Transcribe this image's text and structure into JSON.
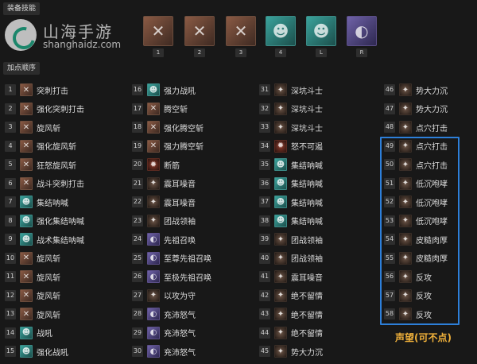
{
  "headers": {
    "equip_skills": "装备技能",
    "skill_order": "加点顺序"
  },
  "watermark": {
    "title": "山海手游",
    "url": "shanghaidz.com"
  },
  "colors": {
    "accent_blue": "#2d7fd9",
    "reputation_text": "#f0b13a",
    "icon_brown": "#6e4a3c",
    "icon_teal": "#2c8b86",
    "icon_purple": "#5b4e88",
    "icon_dark": "#4a3a30"
  },
  "equip": [
    {
      "key": "1",
      "icon": "spear-strike-icon",
      "kind": "brown"
    },
    {
      "key": "2",
      "icon": "whirlwind-icon",
      "kind": "brown"
    },
    {
      "key": "3",
      "icon": "ram-horn-icon",
      "kind": "brown"
    },
    {
      "key": "4",
      "icon": "rallying-cry-icon",
      "kind": "teal"
    },
    {
      "key": "L",
      "icon": "war-cry-icon",
      "kind": "teal"
    },
    {
      "key": "R",
      "icon": "ring-wrath-icon",
      "kind": "purple"
    }
  ],
  "skills": [
    {
      "n": "1",
      "name": "突刺打击",
      "kind": "brown"
    },
    {
      "n": "2",
      "name": "强化突刺打击",
      "kind": "brown"
    },
    {
      "n": "3",
      "name": "旋风斩",
      "kind": "brown"
    },
    {
      "n": "4",
      "name": "强化旋风斩",
      "kind": "brown"
    },
    {
      "n": "5",
      "name": "狂怒旋风斩",
      "kind": "brown"
    },
    {
      "n": "6",
      "name": "战斗突刺打击",
      "kind": "brown"
    },
    {
      "n": "7",
      "name": "集结呐喊",
      "kind": "teal"
    },
    {
      "n": "8",
      "name": "强化集结呐喊",
      "kind": "teal"
    },
    {
      "n": "9",
      "name": "战术集结呐喊",
      "kind": "teal"
    },
    {
      "n": "10",
      "name": "旋风斩",
      "kind": "brown"
    },
    {
      "n": "11",
      "name": "旋风斩",
      "kind": "brown"
    },
    {
      "n": "12",
      "name": "旋风斩",
      "kind": "brown"
    },
    {
      "n": "13",
      "name": "旋风斩",
      "kind": "brown"
    },
    {
      "n": "14",
      "name": "战吼",
      "kind": "teal"
    },
    {
      "n": "15",
      "name": "强化战吼",
      "kind": "teal"
    },
    {
      "n": "16",
      "name": "强力战吼",
      "kind": "teal"
    },
    {
      "n": "17",
      "name": "腾空斩",
      "kind": "brown"
    },
    {
      "n": "18",
      "name": "强化腾空斩",
      "kind": "brown"
    },
    {
      "n": "19",
      "name": "强力腾空斩",
      "kind": "brown"
    },
    {
      "n": "20",
      "name": "断筋",
      "kind": "red"
    },
    {
      "n": "21",
      "name": "震耳噪音",
      "kind": "dark"
    },
    {
      "n": "22",
      "name": "震耳噪音",
      "kind": "dark"
    },
    {
      "n": "23",
      "name": "团战领袖",
      "kind": "dark"
    },
    {
      "n": "24",
      "name": "先祖召唤",
      "kind": "purple"
    },
    {
      "n": "25",
      "name": "至尊先祖召唤",
      "kind": "purple"
    },
    {
      "n": "26",
      "name": "至极先祖召唤",
      "kind": "purple"
    },
    {
      "n": "27",
      "name": "以攻为守",
      "kind": "dark"
    },
    {
      "n": "28",
      "name": "充沛怒气",
      "kind": "purple"
    },
    {
      "n": "29",
      "name": "充沛怒气",
      "kind": "purple"
    },
    {
      "n": "30",
      "name": "充沛怒气",
      "kind": "purple"
    },
    {
      "n": "31",
      "name": "深坑斗士",
      "kind": "dark"
    },
    {
      "n": "32",
      "name": "深坑斗士",
      "kind": "dark"
    },
    {
      "n": "33",
      "name": "深坑斗士",
      "kind": "dark"
    },
    {
      "n": "34",
      "name": "怒不可遏",
      "kind": "red"
    },
    {
      "n": "35",
      "name": "集结呐喊",
      "kind": "teal"
    },
    {
      "n": "36",
      "name": "集结呐喊",
      "kind": "teal"
    },
    {
      "n": "37",
      "name": "集结呐喊",
      "kind": "teal"
    },
    {
      "n": "38",
      "name": "集结呐喊",
      "kind": "teal"
    },
    {
      "n": "39",
      "name": "团战领袖",
      "kind": "dark"
    },
    {
      "n": "40",
      "name": "团战领袖",
      "kind": "dark"
    },
    {
      "n": "41",
      "name": "震耳噪音",
      "kind": "dark"
    },
    {
      "n": "42",
      "name": "绝不留情",
      "kind": "dark"
    },
    {
      "n": "43",
      "name": "绝不留情",
      "kind": "dark"
    },
    {
      "n": "44",
      "name": "绝不留情",
      "kind": "dark"
    },
    {
      "n": "45",
      "name": "势大力沉",
      "kind": "dark"
    },
    {
      "n": "46",
      "name": "势大力沉",
      "kind": "dark"
    },
    {
      "n": "47",
      "name": "势大力沉",
      "kind": "dark"
    },
    {
      "n": "48",
      "name": "点穴打击",
      "kind": "dark"
    },
    {
      "n": "49",
      "name": "点穴打击",
      "kind": "dark"
    },
    {
      "n": "50",
      "name": "点穴打击",
      "kind": "dark"
    },
    {
      "n": "51",
      "name": "低沉咆哮",
      "kind": "dark"
    },
    {
      "n": "52",
      "name": "低沉咆哮",
      "kind": "dark"
    },
    {
      "n": "53",
      "name": "低沉咆哮",
      "kind": "dark"
    },
    {
      "n": "54",
      "name": "皮糙肉厚",
      "kind": "dark"
    },
    {
      "n": "55",
      "name": "皮糙肉厚",
      "kind": "dark"
    },
    {
      "n": "56",
      "name": "反攻",
      "kind": "dark"
    },
    {
      "n": "57",
      "name": "反攻",
      "kind": "dark"
    },
    {
      "n": "58",
      "name": "反攻",
      "kind": "dark"
    }
  ],
  "reputation_label": "声望(可不点)"
}
